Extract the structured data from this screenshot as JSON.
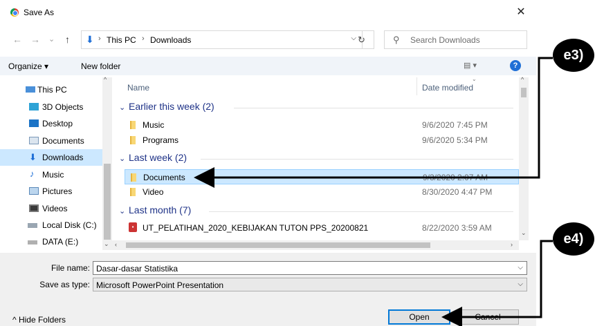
{
  "window": {
    "title": "Save As",
    "close_glyph": "✕"
  },
  "nav": {
    "back_glyph": "←",
    "forward_glyph": "→",
    "recent_glyph": "⌄",
    "up_glyph": "↑",
    "breadcrumb": [
      "This PC",
      "Downloads"
    ],
    "separator": "›",
    "refresh_glyph": "↻",
    "search_placeholder": "Search Downloads"
  },
  "toolbar": {
    "organize": "Organize ▾",
    "new_folder": "New folder",
    "view_glyph": "▤ ▾",
    "help": "?"
  },
  "sidebar": {
    "items": [
      {
        "label": "This PC",
        "icon": "computer-icon"
      },
      {
        "label": "3D Objects",
        "icon": "cube-icon"
      },
      {
        "label": "Desktop",
        "icon": "desktop-icon"
      },
      {
        "label": "Documents",
        "icon": "document-icon"
      },
      {
        "label": "Downloads",
        "icon": "download-icon",
        "selected": true
      },
      {
        "label": "Music",
        "icon": "music-icon"
      },
      {
        "label": "Pictures",
        "icon": "pictures-icon"
      },
      {
        "label": "Videos",
        "icon": "video-icon"
      },
      {
        "label": "Local Disk (C:)",
        "icon": "drive-icon"
      },
      {
        "label": "DATA (E:)",
        "icon": "drive-icon"
      }
    ]
  },
  "filelist": {
    "columns": {
      "name": "Name",
      "date": "Date modified"
    },
    "groups": [
      {
        "title": "Earlier this week (2)",
        "files": [
          {
            "name": "Music",
            "date": "9/6/2020 7:45 PM"
          },
          {
            "name": "Programs",
            "date": "9/6/2020 5:34 PM"
          }
        ]
      },
      {
        "title": "Last week (2)",
        "files": [
          {
            "name": "Documents",
            "date": "9/3/2020 2:07 AM",
            "selected": true
          },
          {
            "name": "Video",
            "date": "8/30/2020 4:47 PM"
          }
        ]
      },
      {
        "title": "Last month (7)",
        "files": [
          {
            "name": "UT_PELATIHAN_2020_KEBIJAKAN TUTON PPS_20200821",
            "date": "8/22/2020 3:59 AM",
            "type": "pdf"
          }
        ]
      }
    ]
  },
  "form": {
    "file_name_label": "File name:",
    "file_name_value": "Dasar-dasar Statistika",
    "save_type_label": "Save as type:",
    "save_type_value": "Microsoft PowerPoint Presentation",
    "hide_folders": "^  Hide Folders",
    "open_button": "Open",
    "cancel_button": "Cancel"
  },
  "annotations": {
    "e3": "e3)",
    "e4": "e4)"
  }
}
